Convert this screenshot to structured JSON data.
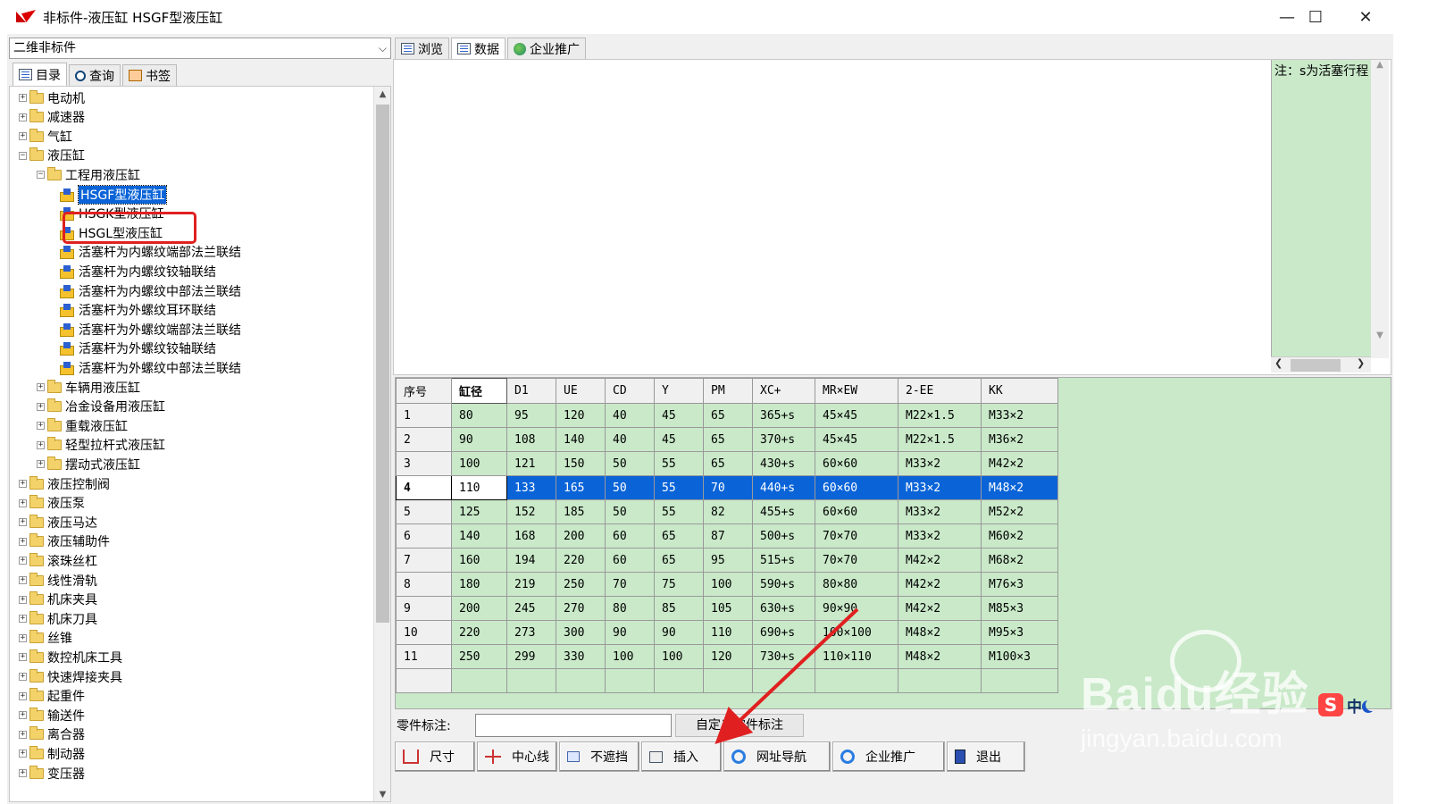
{
  "window": {
    "title": "非标件-液压缸 HSGF型液压缸",
    "minimize": "—",
    "maximize": "☐",
    "close": "✕"
  },
  "left": {
    "combo_value": "二维非标件",
    "tabs": [
      "目录",
      "查询",
      "书签"
    ],
    "tree": [
      {
        "label": "电动机",
        "level": 0,
        "type": "folder",
        "exp": "+"
      },
      {
        "label": "减速器",
        "level": 0,
        "type": "folder",
        "exp": "+"
      },
      {
        "label": "气缸",
        "level": 0,
        "type": "folder",
        "exp": "+"
      },
      {
        "label": "液压缸",
        "level": 0,
        "type": "folder",
        "exp": "−"
      },
      {
        "label": "工程用液压缸",
        "level": 1,
        "type": "folder",
        "exp": "−"
      },
      {
        "label": "HSGF型液压缸",
        "level": 2,
        "type": "part",
        "selected": true
      },
      {
        "label": "HSGK型液压缸",
        "level": 2,
        "type": "part"
      },
      {
        "label": "HSGL型液压缸",
        "level": 2,
        "type": "part"
      },
      {
        "label": "活塞杆为内螺纹端部法兰联结",
        "level": 2,
        "type": "part"
      },
      {
        "label": "活塞杆为内螺纹铰轴联结",
        "level": 2,
        "type": "part"
      },
      {
        "label": "活塞杆为内螺纹中部法兰联结",
        "level": 2,
        "type": "part"
      },
      {
        "label": "活塞杆为外螺纹耳环联结",
        "level": 2,
        "type": "part"
      },
      {
        "label": "活塞杆为外螺纹端部法兰联结",
        "level": 2,
        "type": "part"
      },
      {
        "label": "活塞杆为外螺纹铰轴联结",
        "level": 2,
        "type": "part"
      },
      {
        "label": "活塞杆为外螺纹中部法兰联结",
        "level": 2,
        "type": "part"
      },
      {
        "label": "车辆用液压缸",
        "level": 1,
        "type": "folder",
        "exp": "+"
      },
      {
        "label": "冶金设备用液压缸",
        "level": 1,
        "type": "folder",
        "exp": "+"
      },
      {
        "label": "重载液压缸",
        "level": 1,
        "type": "folder",
        "exp": "+"
      },
      {
        "label": "轻型拉杆式液压缸",
        "level": 1,
        "type": "folder",
        "exp": "+"
      },
      {
        "label": "摆动式液压缸",
        "level": 1,
        "type": "folder",
        "exp": "+"
      },
      {
        "label": "液压控制阀",
        "level": 0,
        "type": "folder",
        "exp": "+"
      },
      {
        "label": "液压泵",
        "level": 0,
        "type": "folder",
        "exp": "+"
      },
      {
        "label": "液压马达",
        "level": 0,
        "type": "folder",
        "exp": "+"
      },
      {
        "label": "液压辅助件",
        "level": 0,
        "type": "folder",
        "exp": "+"
      },
      {
        "label": "滚珠丝杠",
        "level": 0,
        "type": "folder",
        "exp": "+"
      },
      {
        "label": "线性滑轨",
        "level": 0,
        "type": "folder",
        "exp": "+"
      },
      {
        "label": "机床夹具",
        "level": 0,
        "type": "folder",
        "exp": "+"
      },
      {
        "label": "机床刀具",
        "level": 0,
        "type": "folder",
        "exp": "+"
      },
      {
        "label": "丝锥",
        "level": 0,
        "type": "folder",
        "exp": "+"
      },
      {
        "label": "数控机床工具",
        "level": 0,
        "type": "folder",
        "exp": "+"
      },
      {
        "label": "快速焊接夹具",
        "level": 0,
        "type": "folder",
        "exp": "+"
      },
      {
        "label": "起重件",
        "level": 0,
        "type": "folder",
        "exp": "+"
      },
      {
        "label": "输送件",
        "level": 0,
        "type": "folder",
        "exp": "+"
      },
      {
        "label": "离合器",
        "level": 0,
        "type": "folder",
        "exp": "+"
      },
      {
        "label": "制动器",
        "level": 0,
        "type": "folder",
        "exp": "+"
      },
      {
        "label": "变压器",
        "level": 0,
        "type": "folder",
        "exp": "+"
      }
    ]
  },
  "right": {
    "tabs": [
      "浏览",
      "数据",
      "企业推广"
    ],
    "note": "注：s为活塞行程",
    "table": {
      "headers": [
        "序号",
        "缸径",
        "D1",
        "UE",
        "CD",
        "Y",
        "PM",
        "XC+",
        "MR×EW",
        "2-EE",
        "KK"
      ],
      "rows": [
        [
          "1",
          "80",
          "95",
          "120",
          "40",
          "45",
          "65",
          "365+s",
          "45×45",
          "M22×1.5",
          "M33×2"
        ],
        [
          "2",
          "90",
          "108",
          "140",
          "40",
          "45",
          "65",
          "370+s",
          "45×45",
          "M22×1.5",
          "M36×2"
        ],
        [
          "3",
          "100",
          "121",
          "150",
          "50",
          "55",
          "65",
          "430+s",
          "60×60",
          "M33×2",
          "M42×2"
        ],
        [
          "4",
          "110",
          "133",
          "165",
          "50",
          "55",
          "70",
          "440+s",
          "60×60",
          "M33×2",
          "M48×2"
        ],
        [
          "5",
          "125",
          "152",
          "185",
          "50",
          "55",
          "82",
          "455+s",
          "60×60",
          "M33×2",
          "M52×2"
        ],
        [
          "6",
          "140",
          "168",
          "200",
          "60",
          "65",
          "87",
          "500+s",
          "70×70",
          "M33×2",
          "M60×2"
        ],
        [
          "7",
          "160",
          "194",
          "220",
          "60",
          "65",
          "95",
          "515+s",
          "70×70",
          "M42×2",
          "M68×2"
        ],
        [
          "8",
          "180",
          "219",
          "250",
          "70",
          "75",
          "100",
          "590+s",
          "80×80",
          "M42×2",
          "M76×3"
        ],
        [
          "9",
          "200",
          "245",
          "270",
          "80",
          "85",
          "105",
          "630+s",
          "90×90",
          "M42×2",
          "M85×3"
        ],
        [
          "10",
          "220",
          "273",
          "300",
          "90",
          "90",
          "110",
          "690+s",
          "100×100",
          "M48×2",
          "M95×3"
        ],
        [
          "11",
          "250",
          "299",
          "330",
          "100",
          "100",
          "120",
          "730+s",
          "110×110",
          "M48×2",
          "M100×3"
        ],
        [
          "",
          "",
          "",
          "",
          "",
          "",
          "",
          "",
          "",
          "",
          ""
        ]
      ],
      "selected_row": 3
    },
    "part_label": "零件标注:",
    "part_value": "",
    "custom_button": "自定义零件标注",
    "buttons": [
      "尺寸",
      "中心线",
      "不遮挡",
      "插入",
      "网址导航",
      "企业推广",
      "退出"
    ]
  },
  "watermark": {
    "brand": "Baidu经验",
    "url": "jingyan.baidu.com"
  },
  "ime": {
    "logo": "S",
    "mode": "中"
  },
  "colors": {
    "selection": "#0a64d8",
    "grid_bg": "#c9e9c9",
    "annotation_red": "#e02020"
  }
}
